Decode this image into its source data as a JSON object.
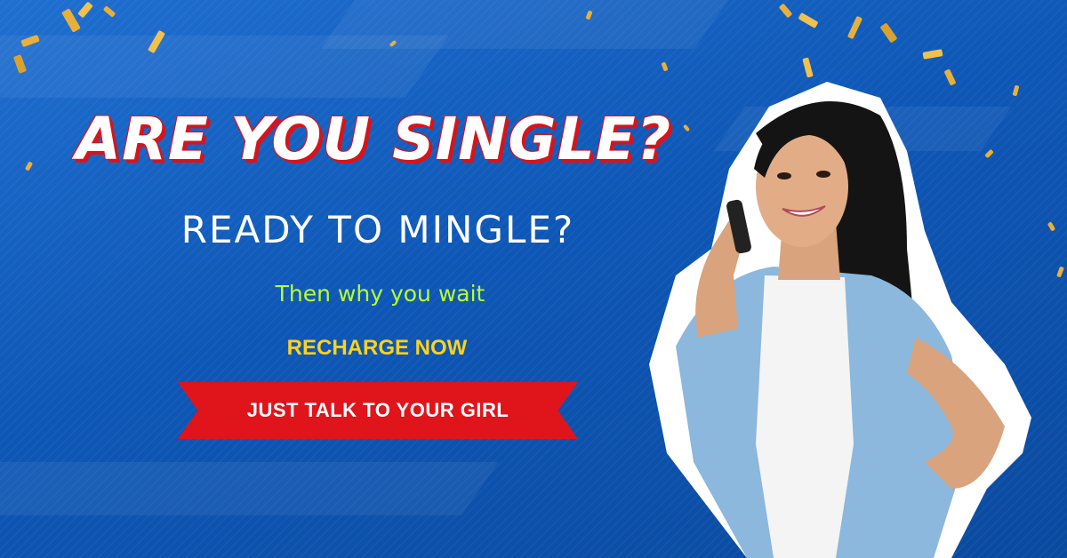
{
  "headline": "ARE YOU SINGLE?",
  "subheadline": "READY TO MINGLE?",
  "tagline": "Then why you wait",
  "recharge_label": "RECHARGE NOW",
  "cta_label": "JUST TALK TO YOUR GIRL",
  "colors": {
    "background": "#0e57b6",
    "headline_outline": "#d7141b",
    "tagline": "#b6ff2e",
    "recharge": "#ffd21a",
    "ribbon": "#e0141b",
    "confetti": "#e8b03a"
  },
  "icons": {
    "photo": "woman-on-phone-photo",
    "decoration": "confetti-icon"
  }
}
